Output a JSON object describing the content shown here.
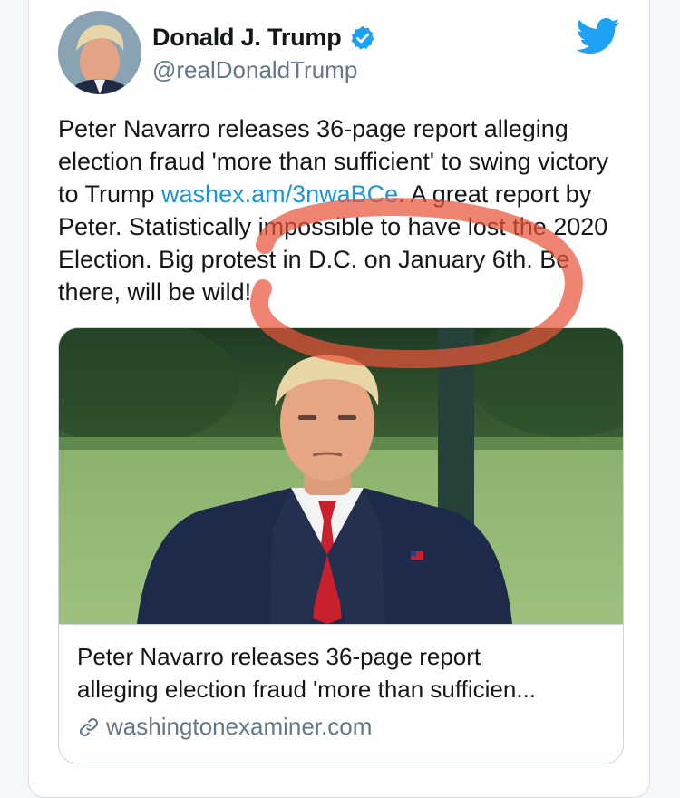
{
  "tweet": {
    "author": {
      "display_name": "Donald J. Trump",
      "handle": "@realDonaldTrump",
      "verified_icon": "verified-badge-icon",
      "avatar": "profile-avatar"
    },
    "brand_icon": "twitter-bird-icon",
    "text": {
      "part1": "Peter Navarro releases 36-page report alleging election fraud 'more than sufficient' to swing victory to Trump ",
      "link": "washex.am/3nwaBCe",
      "part2": ". A great report by Peter. Statistically impossible to have lost the 2020 Election. Big protest in D.C. on January 6th. Be there, will be wild!"
    },
    "link_card": {
      "title_line1": "Peter Navarro releases 36-page report",
      "title_line2": "alleging election fraud 'more than sufficien...",
      "domain": "washingtonexaminer.com",
      "domain_icon": "link-chain-icon"
    }
  },
  "colors": {
    "link_blue": "#1b95e0",
    "verified_blue": "#1da1f2",
    "text_primary": "#14171a",
    "text_secondary": "#657786",
    "annotation_red": "#e8553a"
  }
}
